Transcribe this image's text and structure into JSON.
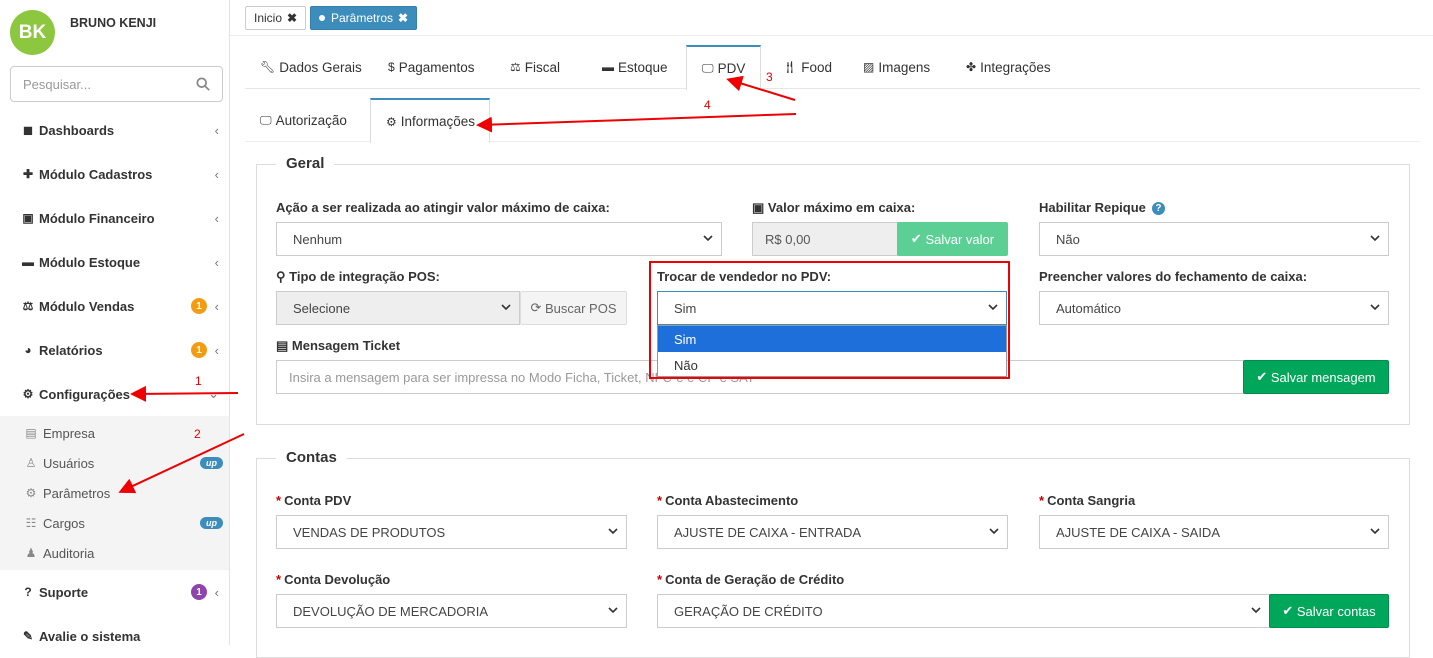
{
  "user": {
    "initials": "BK",
    "name": "BRUNO KENJI"
  },
  "search": {
    "placeholder": "Pesquisar..."
  },
  "menu": {
    "dashboards": "Dashboards",
    "cadastros": "Módulo Cadastros",
    "financeiro": "Módulo Financeiro",
    "estoque": "Módulo Estoque",
    "vendas": "Módulo Vendas",
    "vendas_badge": "1",
    "relatorios": "Relatórios",
    "relatorios_badge": "1",
    "configuracoes": "Configurações",
    "sub": {
      "empresa": "Empresa",
      "usuarios": "Usuários",
      "usuarios_badge": "up",
      "parametros": "Parâmetros",
      "cargos": "Cargos",
      "cargos_badge": "up",
      "auditoria": "Auditoria"
    },
    "suporte": "Suporte",
    "suporte_badge": "1",
    "avalie": "Avalie o sistema"
  },
  "top_tabs": {
    "inicio": "Inicio",
    "parametros": "Parâmetros"
  },
  "tabs": [
    "Dados Gerais",
    "Pagamentos",
    "Fiscal",
    "Estoque",
    "PDV",
    "Food",
    "Imagens",
    "Integrações"
  ],
  "subtabs": [
    "Autorização",
    "Informações"
  ],
  "geral": {
    "legend": "Geral",
    "acao_label": "Ação a ser realizada ao atingir valor máximo de caixa:",
    "acao_value": "Nenhum",
    "valor_max_label": "Valor máximo em caixa:",
    "valor_max_value": "R$ 0,00",
    "salvar_valor": "Salvar valor",
    "repique_label": "Habilitar Repique",
    "repique_value": "Não",
    "pos_label": "Tipo de integração POS:",
    "pos_value": "Selecione",
    "buscar_pos": "Buscar POS",
    "trocar_label": "Trocar de vendedor no PDV:",
    "trocar_value": "Sim",
    "trocar_options": [
      "Sim",
      "Não"
    ],
    "preencher_label": "Preencher valores do fechamento de caixa:",
    "preencher_value": "Automático",
    "mensagem_label": "Mensagem Ticket",
    "mensagem_placeholder": "Insira a mensagem para ser impressa no Modo Ficha, Ticket, NFC-e e CF-e SAT",
    "salvar_mensagem": "Salvar mensagem"
  },
  "contas": {
    "legend": "Contas",
    "pdv_label": "Conta PDV",
    "pdv_value": "VENDAS DE PRODUTOS",
    "abast_label": "Conta Abastecimento",
    "abast_value": "AJUSTE DE CAIXA - ENTRADA",
    "sangria_label": "Conta Sangria",
    "sangria_value": "AJUSTE DE CAIXA - SAIDA",
    "devol_label": "Conta Devolução",
    "devol_value": "DEVOLUÇÃO DE MERCADORIA",
    "credito_label": "Conta de Geração de Crédito",
    "credito_value": "GERAÇÃO DE CRÉDITO",
    "salvar_contas": "Salvar contas"
  },
  "annotations": {
    "n1": "1",
    "n2": "2",
    "n3": "3",
    "n4": "4"
  },
  "colors": {
    "accent": "#3c8dbc",
    "green": "#00a65a",
    "annotation_red": "#e00000",
    "avatar": "#8dc63f"
  }
}
